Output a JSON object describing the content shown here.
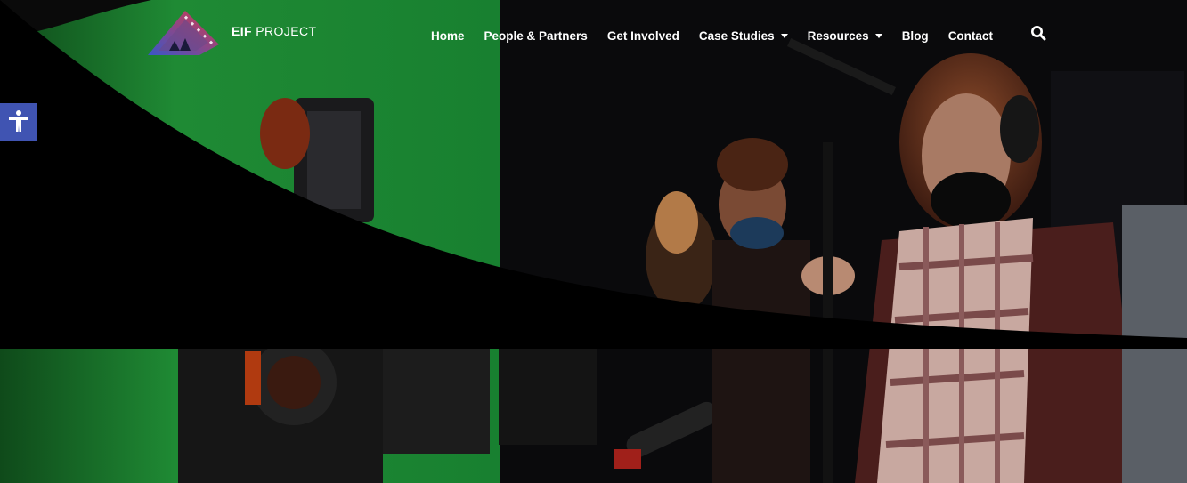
{
  "brand": {
    "name_bold": "EIF",
    "name_rest": " PROJECT"
  },
  "nav": {
    "items": [
      {
        "label": "Home",
        "dropdown": false
      },
      {
        "label": "People & Partners",
        "dropdown": false
      },
      {
        "label": "Get Involved",
        "dropdown": false
      },
      {
        "label": "Case Studies",
        "dropdown": true
      },
      {
        "label": "Resources",
        "dropdown": true
      },
      {
        "label": "Blog",
        "dropdown": false
      },
      {
        "label": "Contact",
        "dropdown": false
      }
    ]
  },
  "icons": {
    "search": "search-icon",
    "accessibility": "accessibility-icon",
    "logo": "film-strip-logo-icon"
  },
  "colors": {
    "accessibility_bg": "#4054b2",
    "green_screen": "#1f8a34",
    "logo_blue": "#3a56c8",
    "logo_red": "#d8394a"
  }
}
